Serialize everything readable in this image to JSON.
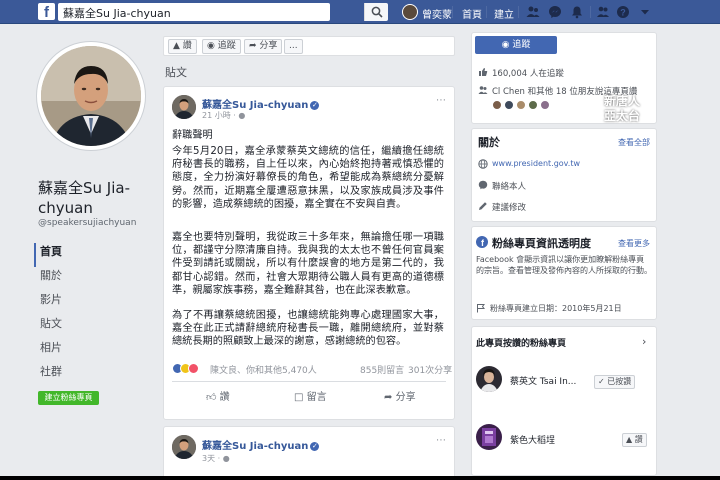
{
  "topbar": {
    "logo": "f",
    "search_value": "蘇嘉全Su Jia-chyuan",
    "user_name": "曾奕蒙",
    "home_label": "首頁",
    "create_label": "建立"
  },
  "profile": {
    "name": "蘇嘉全Su Jia-chyuan",
    "handle": "@speakersujiachyuan",
    "nav": [
      "首頁",
      "關於",
      "影片",
      "貼文",
      "相片",
      "社群"
    ],
    "create_page_label": "建立粉絲專頁"
  },
  "action_bar": {
    "like_label": "讚",
    "follow_label": "追蹤",
    "share_label": "分享",
    "more_label": "..."
  },
  "posts_heading": "貼文",
  "post1": {
    "author": "蘇嘉全Su Jia-chyuan",
    "time": "21 小時",
    "paragraphs": [
      "辭職聲明",
      "今年5月20日，嘉全承蒙蔡英文總統的信任，繼續擔任總統府秘書長的職務，自上任以來，內心始終抱持著戒慎恐懼的態度，全力扮演好幕僚長的角色，希望能成為蔡總統分憂解勞。然而，近期嘉全屢遭惡意抹黑，以及家族成員涉及事件的影響，造成蔡總統的困擾，嘉全實在不安與自責。",
      "嘉全也要特別聲明，我從政三十多年來，無論擔任哪一項職位，都謹守分際清廉自持。我與我的太太也不曾任何官員案件受到請託或關說，所以有什麼誤會的地方是第二代的，我都甘心認錯。然而，社會大眾期待公職人員有更高的道德標準，親屬家族事務，嘉全難辭其咎，也在此深表歉意。",
      "為了不再讓蔡總統困擾，也讓總統能夠專心處理國家大事，嘉全在此正式請辭總統府秘書長一職，離開總統府，並對蔡總統長期的照顧致上最深的謝意，感謝總統的包容。"
    ],
    "reactions_text": "陳文良、你和其他5,470人",
    "comments_count": "855則留言",
    "shares_count": "301次分享",
    "action_like": "讚",
    "action_comment": "留言",
    "action_share": "分享"
  },
  "post2": {
    "author": "蘇嘉全Su Jia-chyuan",
    "time": "3天"
  },
  "right": {
    "like_button_label": "追蹤",
    "likes_line": "160,004 人在追蹤",
    "friends_line": "Cl Chen 和其他 18 位朋友說這專頁讚",
    "about": {
      "title": "關於",
      "see_all": "查看全部",
      "website": "www.president.gov.tw",
      "contact": "聯絡本人",
      "suggest": "建議修改"
    },
    "transparency": {
      "title": "粉絲專頁資訊透明度",
      "see_more": "查看更多",
      "description": "Facebook 會顯示資訊以讓你更加瞭解粉絲專頁的宗旨。查看管理及發佈內容的人所採取的行動。",
      "created": "粉絲專頁建立日期：2010年5月21日"
    },
    "suggested": {
      "title": "此專頁按讚的粉絲專頁",
      "items": [
        {
          "name": "蔡英文 Tsai In...",
          "button": "已按讚"
        },
        {
          "name": "紫色大稻埕",
          "button": "讚"
        }
      ]
    }
  },
  "watermark": {
    "char": "新",
    "text_line1": "新唐人",
    "text_line2": "亞太台"
  },
  "colors": {
    "facebook_blue": "#3b5998",
    "link_blue": "#365899",
    "button_blue": "#4267b2",
    "create_green": "#42b72a",
    "background": "#e9ebee"
  }
}
